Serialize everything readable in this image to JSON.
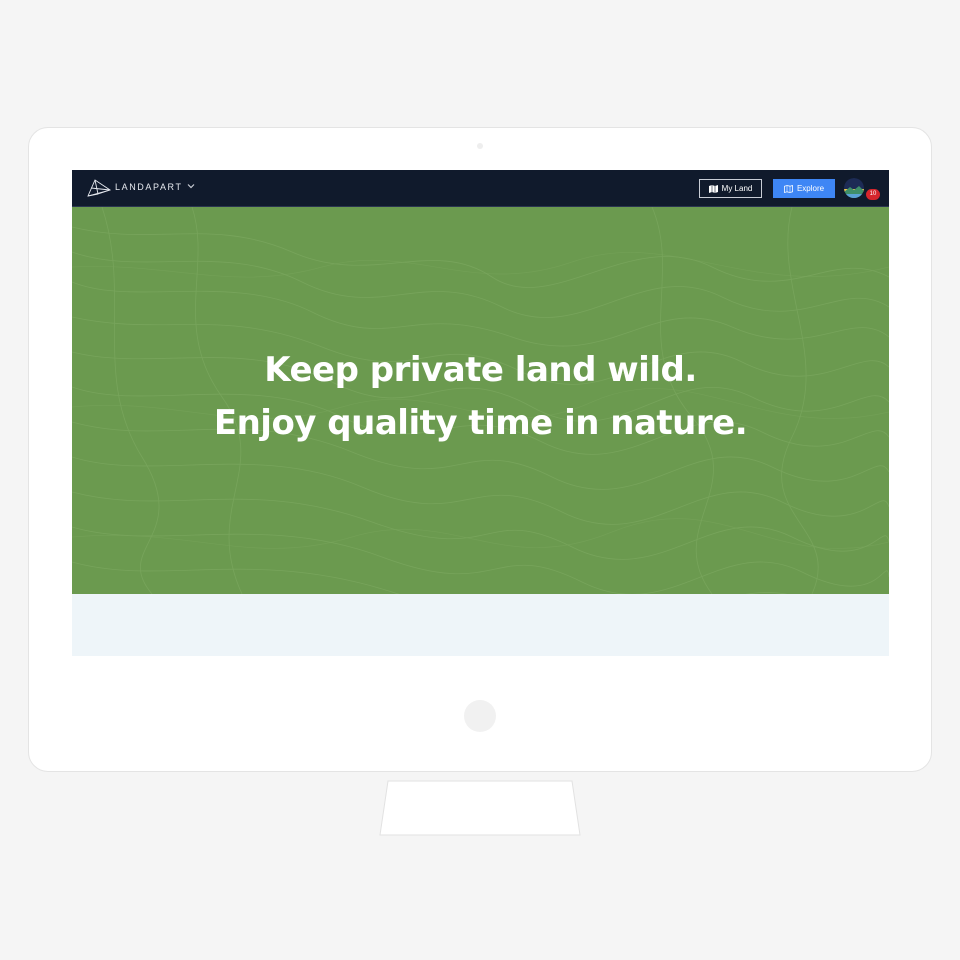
{
  "navbar": {
    "brand": "LANDAPART",
    "my_land_label": "My Land",
    "explore_label": "Explore",
    "notification_count": "10"
  },
  "hero": {
    "line1": "Keep private land wild.",
    "line2": "Enjoy quality time in nature."
  },
  "icons": {
    "logo": "landapart-logo-icon",
    "brand_menu": "chevron-down-icon",
    "my_land": "map-icon",
    "explore": "map-outline-icon",
    "avatar": "mountain-avatar"
  },
  "colors": {
    "navbar_bg": "#101a2c",
    "hero_green": "#6b9a4f",
    "explore_blue": "#3e86f5",
    "badge_red": "#d6262c",
    "below_bg": "#eef5f9"
  }
}
